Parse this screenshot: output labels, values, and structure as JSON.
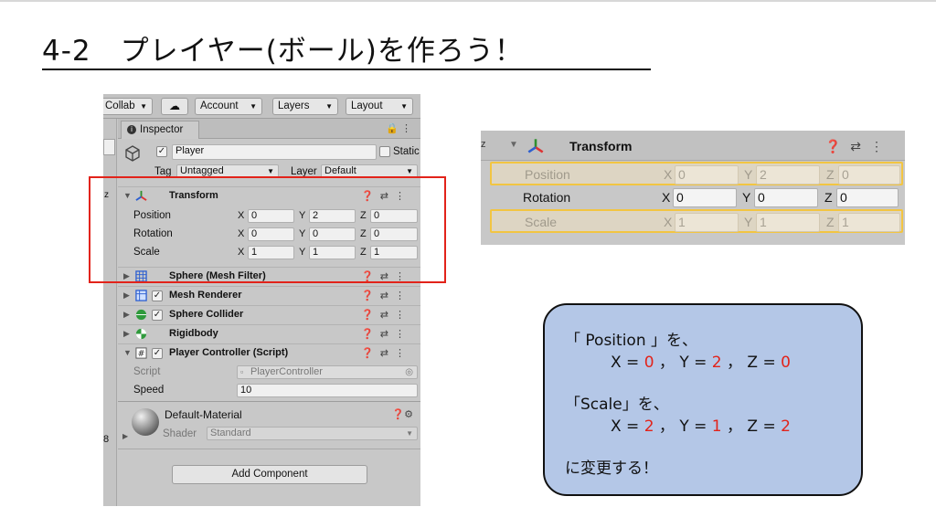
{
  "slide": {
    "title": "4-2　プレイヤー(ボール)を作ろう！"
  },
  "toolbar": {
    "collab": "Collab",
    "cloud_icon": "cloud-icon",
    "account": "Account",
    "layers": "Layers",
    "layout": "Layout"
  },
  "inspector": {
    "tab_label": "Inspector",
    "object": {
      "name": "Player",
      "static_label": "Static",
      "tag_label": "Tag",
      "tag_value": "Untagged",
      "layer_label": "Layer",
      "layer_value": "Default"
    },
    "transform": {
      "title": "Transform",
      "position": {
        "label": "Position",
        "x": "0",
        "y": "2",
        "z": "0"
      },
      "rotation": {
        "label": "Rotation",
        "x": "0",
        "y": "0",
        "z": "0"
      },
      "scale": {
        "label": "Scale",
        "x": "1",
        "y": "1",
        "z": "1"
      }
    },
    "components": [
      {
        "name": "Sphere (Mesh Filter)",
        "icon": "mesh-filter-icon"
      },
      {
        "name": "Mesh Renderer",
        "icon": "mesh-renderer-icon"
      },
      {
        "name": "Sphere Collider",
        "icon": "sphere-collider-icon"
      },
      {
        "name": "Rigidbody",
        "icon": "rigidbody-icon"
      },
      {
        "name": "Player Controller (Script)",
        "icon": "script-icon"
      }
    ],
    "script_label": "Script",
    "script_value": "PlayerController",
    "speed_label": "Speed",
    "speed_value": "10",
    "material_name": "Default-Material",
    "shader_label": "Shader",
    "shader_value": "Standard",
    "add_component": "Add Component",
    "side_number": "8",
    "side_z": "z"
  },
  "zoom_transform": {
    "title": "Transform",
    "side_z": "z",
    "rows": [
      {
        "label": "Position",
        "x": "0",
        "y": "2",
        "z": "0"
      },
      {
        "label": "Rotation",
        "x": "0",
        "y": "0",
        "z": "0"
      },
      {
        "label": "Scale",
        "x": "1",
        "y": "1",
        "z": "1"
      }
    ],
    "axis_x": "X",
    "axis_y": "Y",
    "axis_z": "Z"
  },
  "callout": {
    "line1": "「 Position 」を、",
    "pos_x_pre": "X = ",
    "pos_x": "0",
    "pos_y_pre": " ， Y = ",
    "pos_y": "2",
    "pos_z_pre": " ， Z = ",
    "pos_z": "0",
    "line3": "「Scale」を、",
    "scl_x_pre": "X = ",
    "scl_x": "2",
    "scl_y_pre": " ， Y = ",
    "scl_y": "1",
    "scl_z_pre": " ， Z = ",
    "scl_z": "2",
    "line5": "に変更する！"
  },
  "colors": {
    "highlight_red": "#e2231a",
    "callout_fill": "#b4c7e7",
    "highlight_yellow": "#f2c542"
  }
}
